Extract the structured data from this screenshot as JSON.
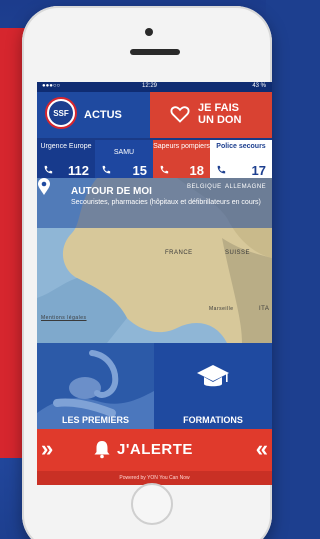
{
  "status_bar": {
    "carrier": "●●●○○",
    "time": "12:29",
    "battery": "43 %"
  },
  "header": {
    "logo_text": "SSF",
    "actus_label": "ACTUS",
    "don_line1": "JE FAIS",
    "don_line2": "UN DON"
  },
  "numbers": [
    {
      "label": "Urgence Europe",
      "number": "112"
    },
    {
      "label": "SAMU",
      "number": "15"
    },
    {
      "label": "Sapeurs pompiers",
      "number": "18"
    },
    {
      "label": "Police secours",
      "number": "17"
    }
  ],
  "map": {
    "title": "AUTOUR DE MOI",
    "subtitle": "Secouristes, pharmacies (hôpitaux et défibrillateurs en cours)",
    "labels": {
      "belgique": "BELGIQUE",
      "allemagne": "ALLEMAGNE",
      "france": "FRANCE",
      "suisse": "SUISSE",
      "marseille": "Marseille",
      "ita": "ITA",
      "legal": "Mentions légales"
    }
  },
  "tiles": {
    "left": "LES PREMIERS",
    "right": "FORMATIONS"
  },
  "alert": {
    "label": "J'ALERTE",
    "powered": "Powered by YON You Can Now"
  },
  "colors": {
    "blue": "#1d3f8f",
    "red": "#d94232",
    "alert_red": "#e03a2c"
  }
}
